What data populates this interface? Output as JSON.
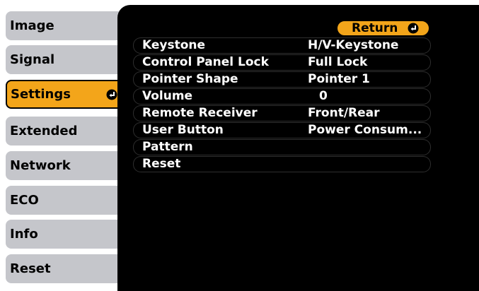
{
  "sidebar": {
    "items": [
      {
        "label": "Image"
      },
      {
        "label": "Signal"
      },
      {
        "label": "Settings"
      },
      {
        "label": "Extended"
      },
      {
        "label": "Network"
      },
      {
        "label": "ECO"
      },
      {
        "label": "Info"
      },
      {
        "label": "Reset"
      }
    ],
    "selected_index": 2
  },
  "panel": {
    "return_label": "Return",
    "rows": [
      {
        "label": "Keystone",
        "value": "H/V-Keystone"
      },
      {
        "label": "Control Panel Lock",
        "value": "Full Lock"
      },
      {
        "label": "Pointer Shape",
        "value": "Pointer 1"
      },
      {
        "label": "Volume",
        "value": "0"
      },
      {
        "label": "Remote Receiver",
        "value": "Front/Rear"
      },
      {
        "label": "User Button",
        "value": "Power Consum..."
      },
      {
        "label": "Pattern",
        "value": ""
      },
      {
        "label": "Reset",
        "value": ""
      }
    ]
  },
  "colors": {
    "accent": "#f3a51a",
    "sidebar_item": "#c5c6cb",
    "panel_bg": "#000000",
    "text_light": "#ffffff"
  },
  "icons": {
    "enter": "enter-arrow-icon"
  }
}
